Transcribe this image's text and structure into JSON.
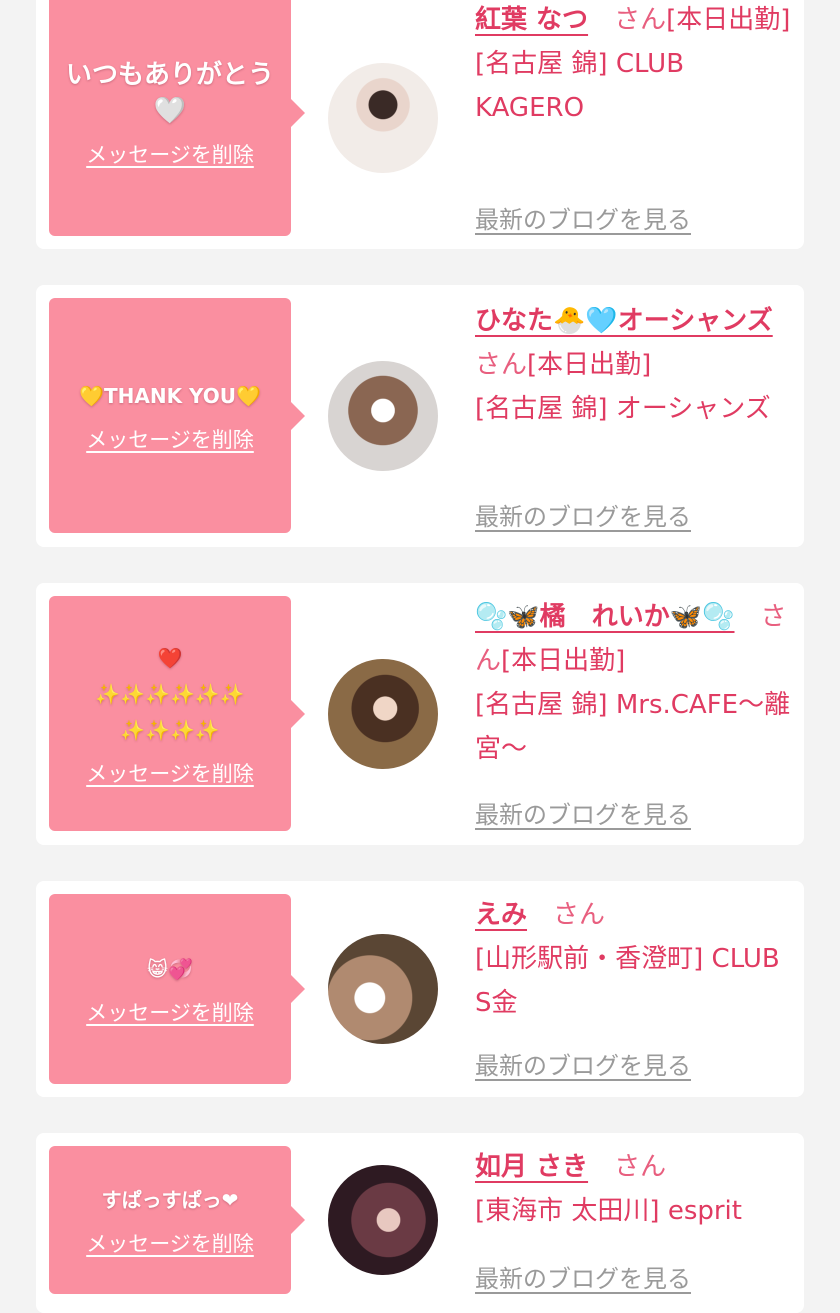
{
  "colors": {
    "background": "#f3f3f3",
    "card": "#ffffff",
    "bubble": "#fa8fa0",
    "accent": "#e03b62",
    "muted": "#9a9a9a"
  },
  "common": {
    "delete_label": "メッセージを削除",
    "blog_label": "最新のブログを見る",
    "honorific": "さん"
  },
  "cards": [
    {
      "message": "いつもありがとう\n🤍",
      "name": "紅葉 なつ",
      "status": "[本日出勤]",
      "shop": "[名古屋 錦] CLUB KAGERO"
    },
    {
      "message": "💛THANK YOU💛",
      "name": "ひなた🐣🩵オーシャンズ",
      "status": "[本日出勤]",
      "shop": "[名古屋 錦] オーシャンズ"
    },
    {
      "message": "❤️\n✨✨✨✨✨✨\n✨✨✨✨",
      "name": "🫧🦋橘　れいか🦋🫧",
      "status": "[本日出勤]",
      "shop": "[名古屋 錦] Mrs.CAFE〜離宮〜"
    },
    {
      "message": "😸💞",
      "name": "えみ",
      "status": "",
      "shop": "[山形駅前・香澄町] CLUB S金"
    },
    {
      "message": "すぱっすぱっ❤",
      "name": "如月 さき",
      "status": "",
      "shop": "[東海市 太田川] esprit"
    }
  ]
}
